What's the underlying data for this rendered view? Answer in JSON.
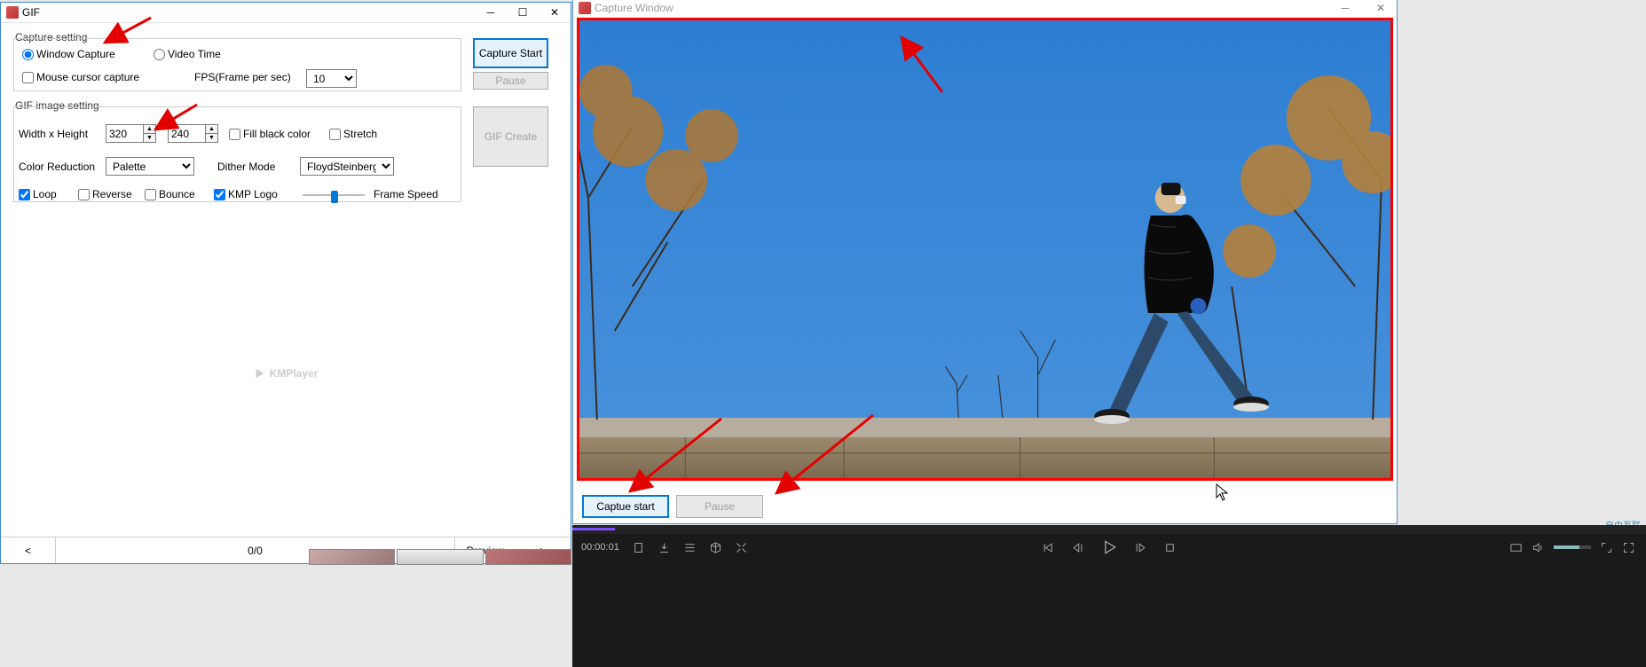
{
  "gif_window": {
    "title": "GIF",
    "capture_setting": {
      "legend": "Capture setting",
      "window_capture": "Window Capture",
      "video_time": "Video Time",
      "mouse_cursor": "Mouse cursor capture",
      "fps_label": "FPS(Frame per sec)",
      "fps_value": "10"
    },
    "gif_setting": {
      "legend": "GIF image setting",
      "wh_label": "Width x Height",
      "width_value": "320",
      "height_value": "240",
      "fill_black": "Fill black color",
      "stretch": "Stretch",
      "color_reduction_label": "Color Reduction",
      "color_reduction_value": "Palette",
      "dither_label": "Dither Mode",
      "dither_value": "FloydSteinberg",
      "loop": "Loop",
      "reverse": "Reverse",
      "bounce": "Bounce",
      "kmp_logo": "KMP Logo",
      "frame_speed": "Frame Speed"
    },
    "buttons": {
      "capture_start": "Capture Start",
      "pause": "Pause",
      "gif_create": "GIF Create"
    },
    "watermark": "KMPlayer",
    "footer": {
      "prev": "<",
      "counter": "0/0",
      "preview": "Preview",
      "next": ">"
    }
  },
  "capture_window": {
    "title": "Capture Window",
    "capture_start": "Captue start",
    "pause": "Pause"
  },
  "player": {
    "timecode": "00:00:01",
    "watermark1": "自由互联"
  }
}
